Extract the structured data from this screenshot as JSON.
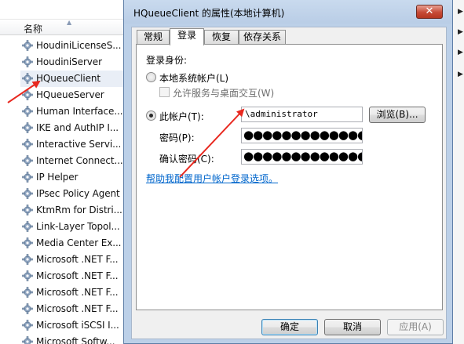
{
  "services": {
    "column_header": "名称",
    "rows": [
      "HoudiniLicenseS...",
      "HoudiniServer",
      "HQueueClient",
      "HQueueServer",
      "Human Interface...",
      "IKE and AuthIP I...",
      "Interactive Servi...",
      "Internet Connect...",
      "IP Helper",
      "IPsec Policy Agent",
      "KtmRm for Distri...",
      "Link-Layer Topol...",
      "Media Center Ex...",
      "Microsoft .NET F...",
      "Microsoft .NET F...",
      "Microsoft .NET F...",
      "Microsoft .NET F...",
      "Microsoft iSCSI I...",
      "Microsoft Softw..."
    ],
    "selected_index": 2
  },
  "dialog": {
    "title": "HQueueClient 的属性(本地计算机)",
    "close_label": "✕",
    "tabs": [
      "常规",
      "登录",
      "恢复",
      "依存关系"
    ],
    "active_tab": "登录",
    "logon_as_label": "登录身份:",
    "local_system_label": "本地系统帐户(L)",
    "allow_desktop_label": "允许服务与桌面交互(W)",
    "this_account_label": "此帐户(T):",
    "account_value": "\\administrator",
    "browse_label": "浏览(B)...",
    "password_label": "密码(P):",
    "confirm_password_label": "确认密码(C):",
    "password_mask": "●●●●●●●●●●●●●●●",
    "confirm_password_mask": "●●●●●●●●●●●●●●●",
    "help_link": "帮助我配置用户帐户登录选项。",
    "ok_label": "确定",
    "cancel_label": "取消",
    "apply_label": "应用(A)"
  },
  "colors": {
    "annotation_arrow": "#e8281f",
    "title_bar": "#bcd0e8",
    "link": "#0066cc"
  }
}
